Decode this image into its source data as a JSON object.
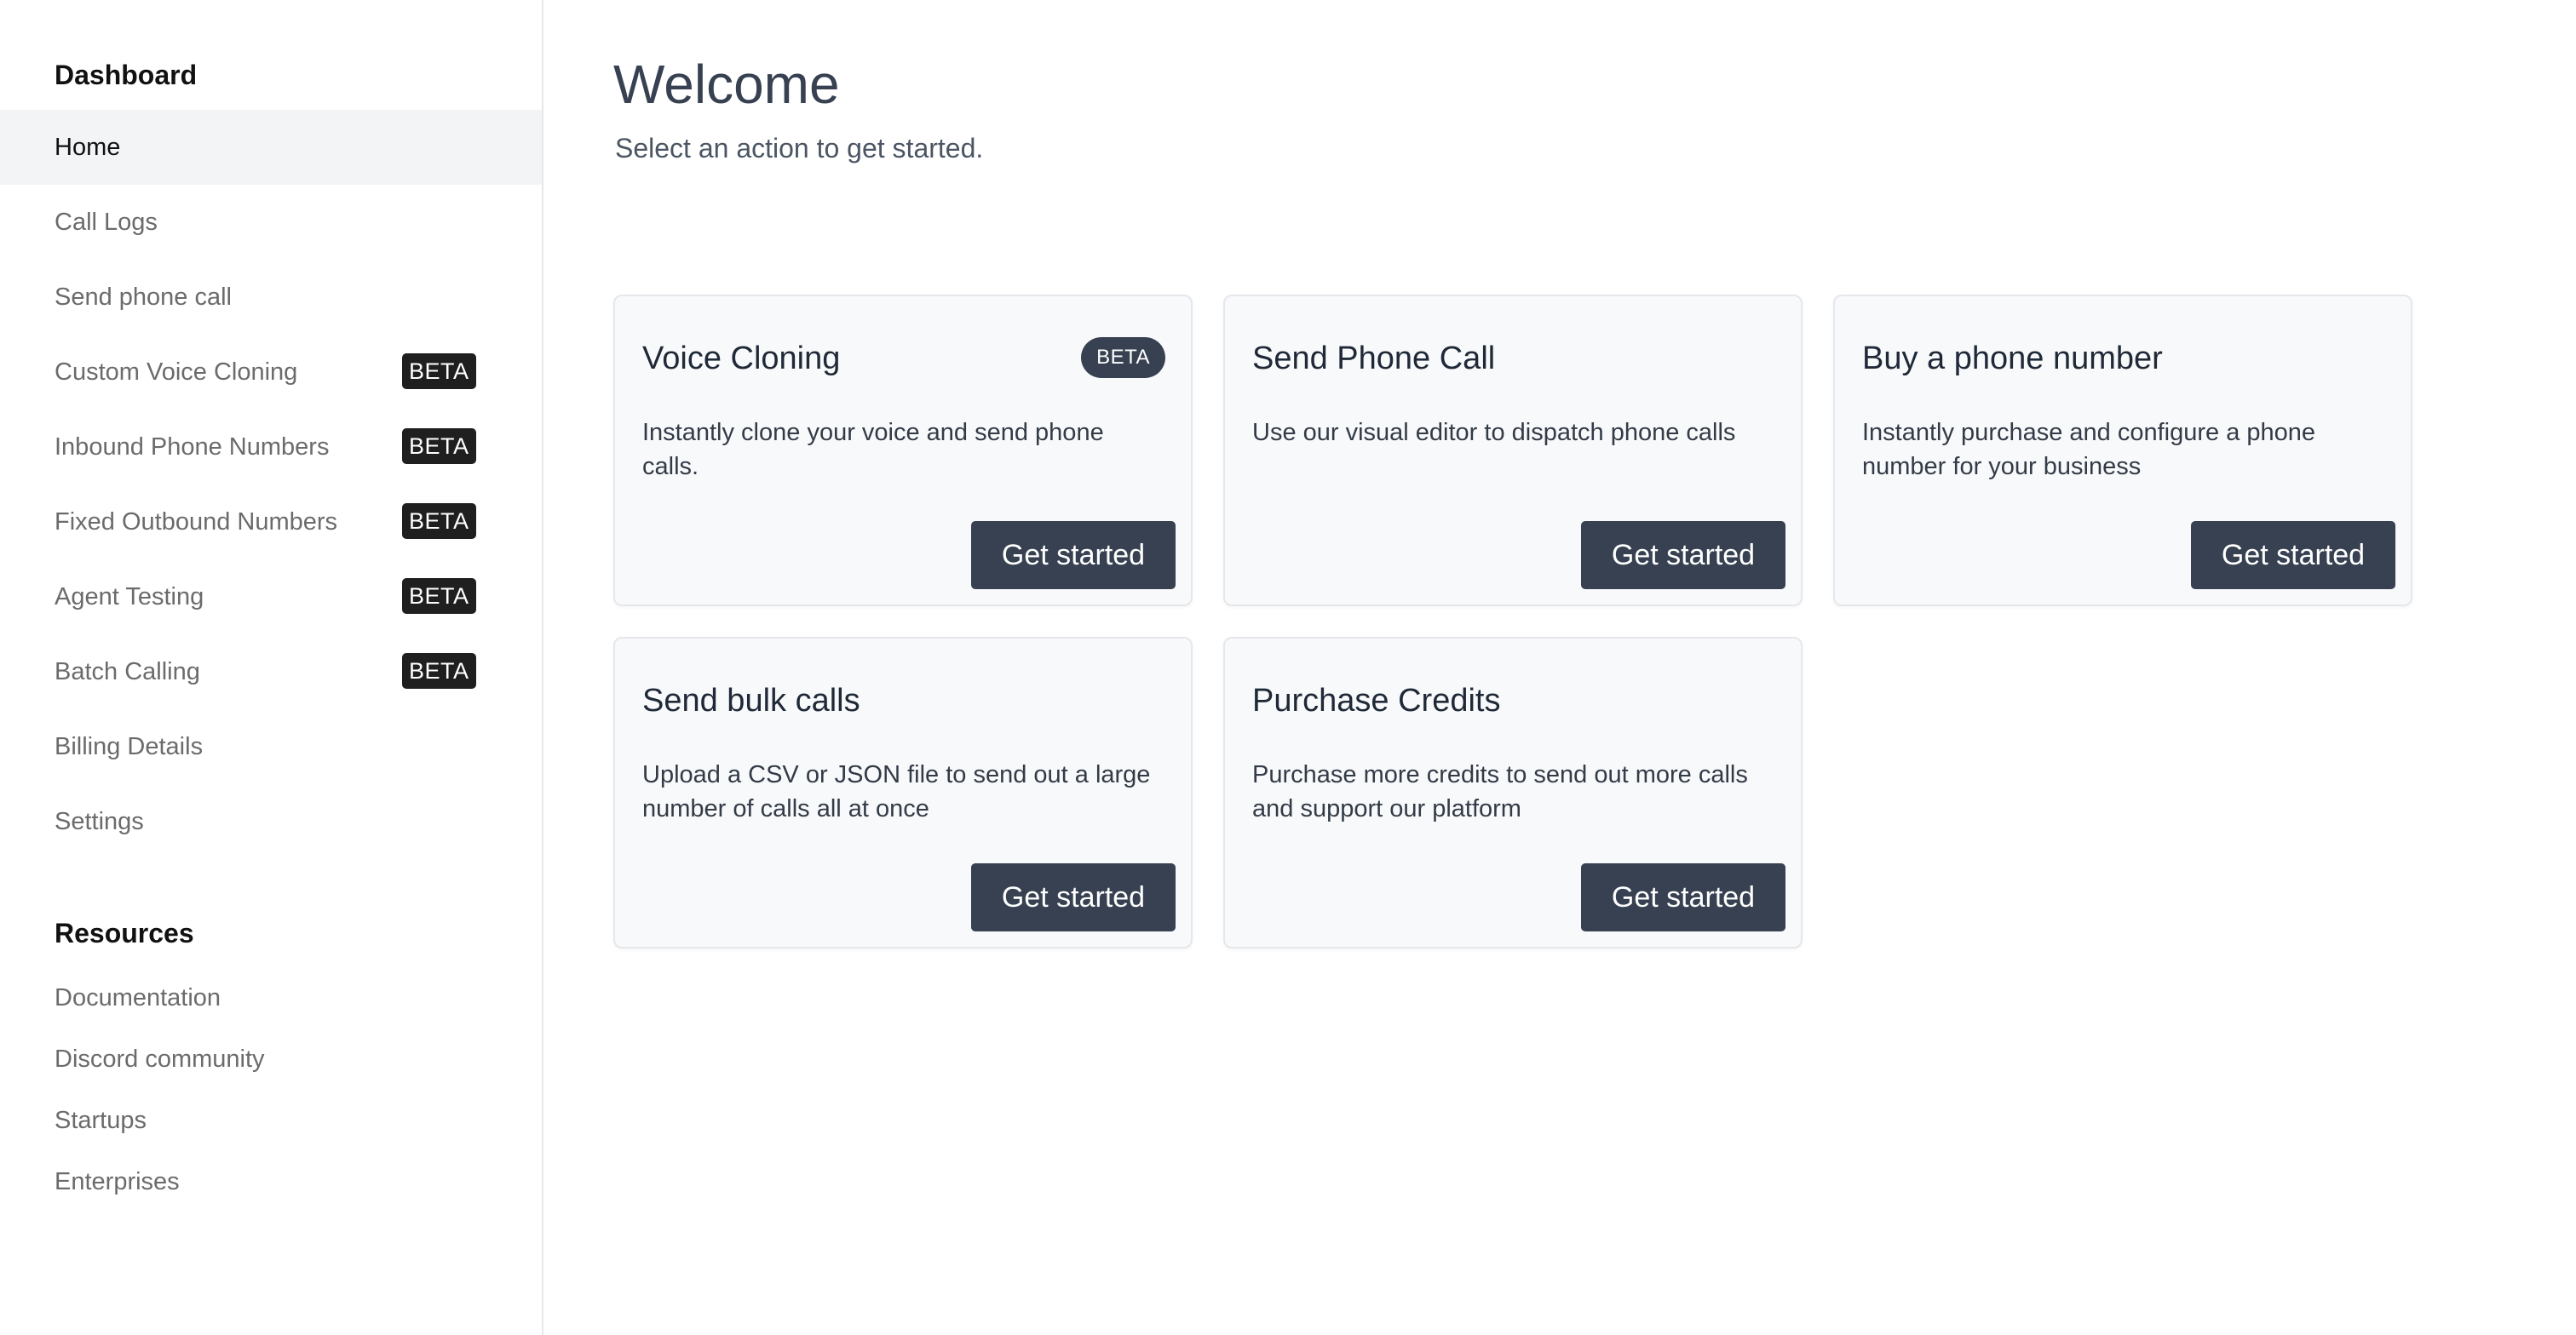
{
  "sidebar": {
    "dashboard_heading": "Dashboard",
    "items": [
      {
        "label": "Home",
        "active": true
      },
      {
        "label": "Call Logs"
      },
      {
        "label": "Send phone call"
      },
      {
        "label": "Custom Voice Cloning",
        "badge": "BETA"
      },
      {
        "label": "Inbound Phone Numbers",
        "badge": "BETA"
      },
      {
        "label": "Fixed Outbound Numbers",
        "badge": "BETA"
      },
      {
        "label": "Agent Testing",
        "badge": "BETA"
      },
      {
        "label": "Batch Calling",
        "badge": "BETA"
      },
      {
        "label": "Billing Details"
      },
      {
        "label": "Settings"
      }
    ],
    "resources_heading": "Resources",
    "resources": [
      {
        "label": "Documentation"
      },
      {
        "label": "Discord community"
      },
      {
        "label": "Startups"
      },
      {
        "label": "Enterprises"
      }
    ]
  },
  "main": {
    "title": "Welcome",
    "subtitle": "Select an action to get started.",
    "cards": [
      {
        "title": "Voice Cloning",
        "badge": "BETA",
        "description": "Instantly clone your voice and send phone calls.",
        "button": "Get started"
      },
      {
        "title": "Send Phone Call",
        "description": "Use our visual editor to dispatch phone calls",
        "button": "Get started"
      },
      {
        "title": "Buy a phone number",
        "description": "Instantly purchase and configure a phone number for your business",
        "button": "Get started"
      },
      {
        "title": "Send bulk calls",
        "description": "Upload a CSV or JSON file to send out a large number of calls all at once",
        "button": "Get started"
      },
      {
        "title": "Purchase Credits",
        "description": "Purchase more credits to send out more calls and support our platform",
        "button": "Get started"
      }
    ]
  },
  "colors": {
    "button_bg": "#374151",
    "badge_bg": "#1f1f1f",
    "card_bg": "#f8f9fb",
    "active_nav_bg": "#f3f4f6"
  }
}
